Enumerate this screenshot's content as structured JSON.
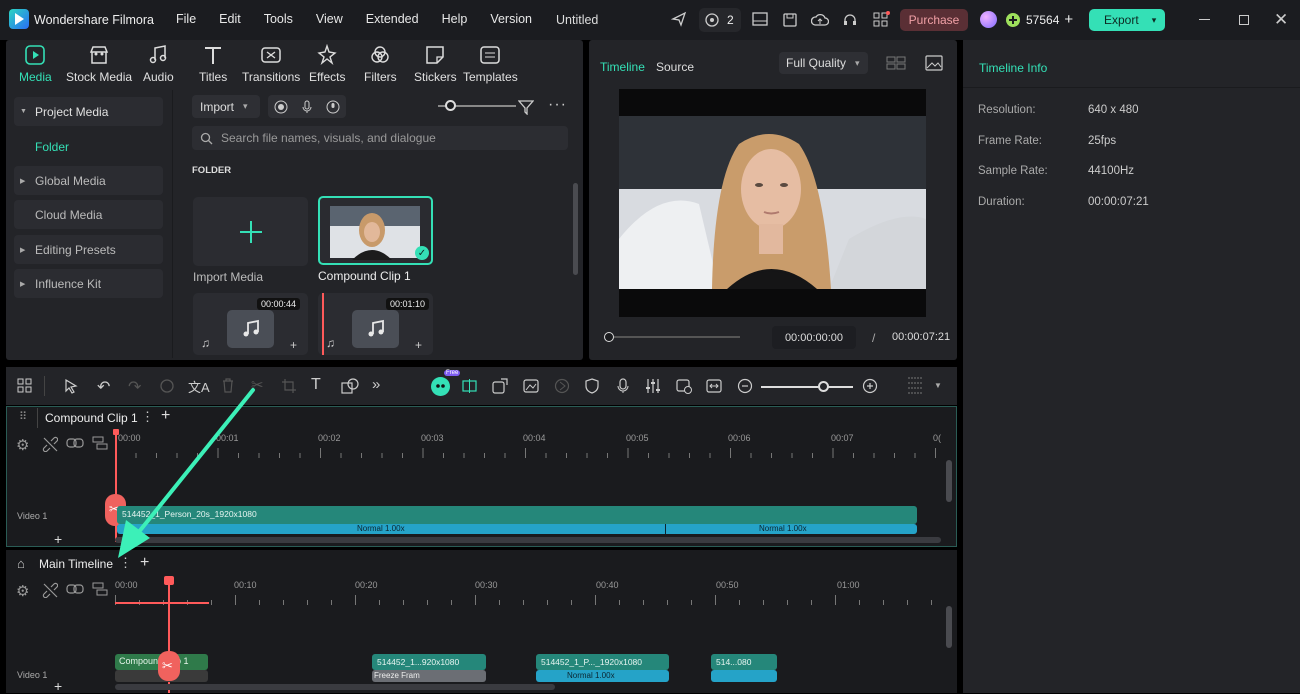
{
  "app": {
    "name": "Wondershare Filmora",
    "project_title": "Untitled"
  },
  "menu": [
    "File",
    "Edit",
    "Tools",
    "View",
    "Extended",
    "Help",
    "Version"
  ],
  "titlebar": {
    "collab_count": "2",
    "purchase": "Purchase",
    "credits": "57564",
    "export": "Export"
  },
  "media_tabs": [
    "Media",
    "Stock Media",
    "Audio",
    "Titles",
    "Transitions",
    "Effects",
    "Filters",
    "Stickers",
    "Templates"
  ],
  "sidebar": {
    "items": [
      {
        "label": "Project Media"
      },
      {
        "label": "Folder"
      },
      {
        "label": "Global Media"
      },
      {
        "label": "Cloud Media"
      },
      {
        "label": "Editing Presets"
      },
      {
        "label": "Influence Kit"
      }
    ]
  },
  "library": {
    "import_label": "Import",
    "search_placeholder": "Search file names, visuals, and dialogue",
    "section": "FOLDER",
    "import_media": "Import Media",
    "compound_clip": "Compound Clip 1",
    "audio1_duration": "00:00:44",
    "audio2_duration": "00:01:10"
  },
  "player": {
    "tab_timeline": "Timeline",
    "tab_source": "Source",
    "quality": "Full Quality",
    "current_time": "00:00:00:00",
    "separator": "/",
    "total_time": "00:00:07:21"
  },
  "info": {
    "title": "Timeline Info",
    "rows": [
      {
        "label": "Resolution:",
        "value": "640 x 480"
      },
      {
        "label": "Frame Rate:",
        "value": "25fps"
      },
      {
        "label": "Sample Rate:",
        "value": "44100Hz"
      },
      {
        "label": "Duration:",
        "value": "00:00:07:21"
      }
    ]
  },
  "toolbar": {
    "free_badge": "Free"
  },
  "compound_timeline": {
    "tab": "Compound Clip 1",
    "ruler": [
      "00:00",
      "00:01",
      "00:02",
      "00:03",
      "00:04",
      "00:05",
      "00:06",
      "00:07",
      "0("
    ],
    "track_label": "Video 1",
    "clip_name": "514452_1_Person_20s_1920x1080",
    "speed1": "Normal 1.00x",
    "speed2": "Normal 1.00x"
  },
  "main_timeline": {
    "tab": "Main Timeline",
    "ruler": [
      "00:00",
      "00:10",
      "00:20",
      "00:30",
      "00:40",
      "00:50",
      "01:00"
    ],
    "track_label": "Video 1",
    "clips": [
      {
        "name": "Compound Clip 1"
      },
      {
        "name": "514452_1...920x1080",
        "sub": "Freeze Fram"
      },
      {
        "name": "514452_1_P..._1920x1080",
        "sub": "Normal 1.00x"
      },
      {
        "name": "514...080"
      }
    ]
  }
}
